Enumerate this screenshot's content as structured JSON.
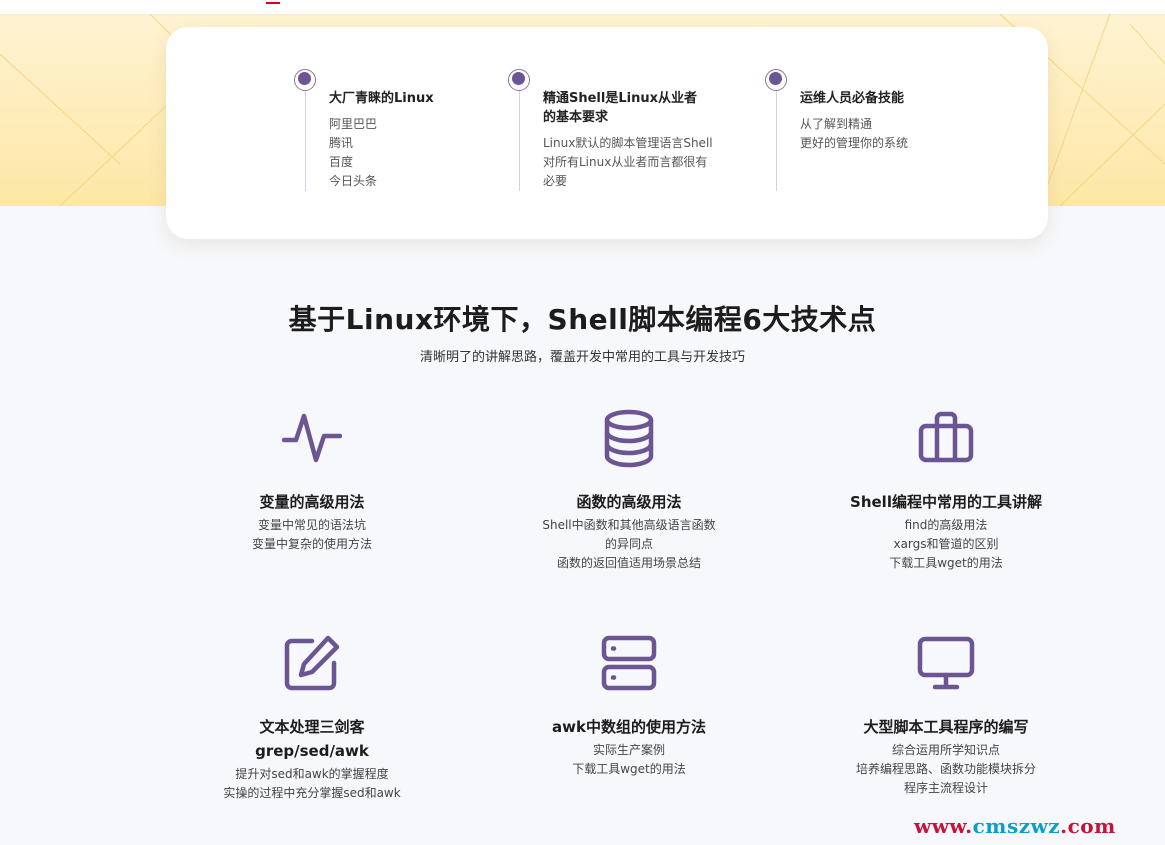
{
  "features": [
    {
      "title": "大厂青睐的Linux",
      "lines": [
        "阿里巴巴",
        "腾讯",
        "百度",
        "今日头条"
      ]
    },
    {
      "title_lines": [
        "精通Shell是Linux从业者",
        "的基本要求"
      ],
      "lines": [
        "Linux默认的脚本管理语言Shell",
        "对所有Linux从业者而言都很有",
        "必要"
      ]
    },
    {
      "title": "运维人员必备技能",
      "lines": [
        "从了解到精通",
        "更好的管理你的系统"
      ]
    }
  ],
  "section": {
    "title": "基于Linux环境下，Shell脚本编程6大技术点",
    "subtitle": "清晰明了的讲解思路，覆盖开发中常用的工具与开发技巧"
  },
  "skills": [
    {
      "icon": "pulse-icon",
      "title": "变量的高级用法",
      "lines": [
        "变量中常见的语法坑",
        "变量中复杂的使用方法"
      ]
    },
    {
      "icon": "database-icon",
      "title": "函数的高级用法",
      "lines": [
        "Shell中函数和其他高级语言函数",
        "的异同点",
        "函数的返回值适用场景总结"
      ]
    },
    {
      "icon": "briefcase-icon",
      "title": "Shell编程中常用的工具讲解",
      "lines": [
        "find的高级用法",
        "xargs和管道的区别",
        "下载工具wget的用法"
      ]
    },
    {
      "icon": "edit-icon",
      "title_lines": [
        "文本处理三剑客",
        "grep/sed/awk"
      ],
      "lines": [
        "提升对sed和awk的掌握程度",
        "实操的过程中充分掌握sed和awk"
      ]
    },
    {
      "icon": "server-icon",
      "title": "awk中数组的使用方法",
      "lines": [
        "实际生产案例",
        "下载工具wget的用法"
      ]
    },
    {
      "icon": "monitor-icon",
      "title": "大型脚本工具程序的编写",
      "lines": [
        "综合运用所学知识点",
        "培养编程思路、函数功能模块拆分",
        "程序主流程设计"
      ]
    }
  ],
  "watermark": {
    "prefix": "www.",
    "em": "cmszwz",
    "suffix": ".com"
  },
  "colors": {
    "accent": "#6b5592",
    "band_top": "#fff3d2",
    "band_bottom": "#fde7a6",
    "watermark_red": "#c7123a",
    "watermark_teal": "#0aa0c8"
  }
}
